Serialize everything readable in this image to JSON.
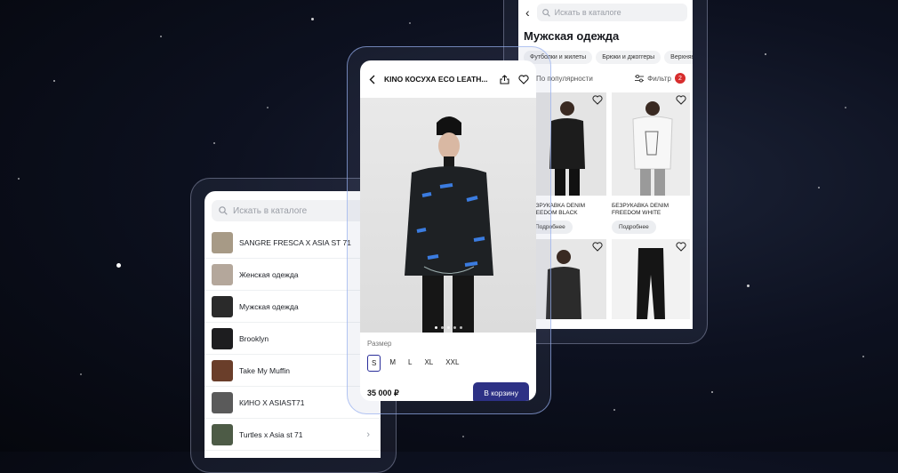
{
  "colors": {
    "accent": "#2d3185",
    "badge": "#d72d2d",
    "background": "#0b0f1b"
  },
  "catalog_left": {
    "search_placeholder": "Искать в каталоге",
    "items": [
      {
        "label": "SANGRE FRESCA X ASIA ST 71",
        "thumb": "#a79a86"
      },
      {
        "label": "Женская одежда",
        "thumb": "#b4a79b"
      },
      {
        "label": "Мужская одежда",
        "thumb": "#2a2a2a"
      },
      {
        "label": "Brooklyn",
        "thumb": "#1d1d1f"
      },
      {
        "label": "Take My Muffin",
        "thumb": "#6a3e2a"
      },
      {
        "label": "КИНО X ASIAST71",
        "thumb": "#5a5a5a"
      },
      {
        "label": "Turtles x Asia st 71",
        "thumb": "#4d5b46"
      }
    ],
    "chevron": "›"
  },
  "product": {
    "back_icon": "chevron-left",
    "title": "KINO КОСУХА ECO LEATH...",
    "share_icon": "share",
    "favorite_icon": "heart",
    "size_label": "Размер",
    "sizes": [
      "S",
      "M",
      "L",
      "XL",
      "XXL"
    ],
    "selected_size": "S",
    "price": "35 000 ₽",
    "cart_button": "В корзину"
  },
  "catalog_right": {
    "search_placeholder": "Искать в каталоге",
    "title": "Мужская одежда",
    "chips": [
      "Футболки и жилеты",
      "Брюки и джоггеры",
      "Верхняя"
    ],
    "sort_label": "По популярности",
    "filter_label": "Фильтр",
    "filter_count": "2",
    "cards": [
      {
        "title": "БЕЗРУКАВКА DENIM FREEDOM BLACK",
        "more": "Подробнее"
      },
      {
        "title": "БЕЗРУКАВКА DENIM FREEDOM WHITE",
        "more": "Подробнее"
      }
    ]
  }
}
